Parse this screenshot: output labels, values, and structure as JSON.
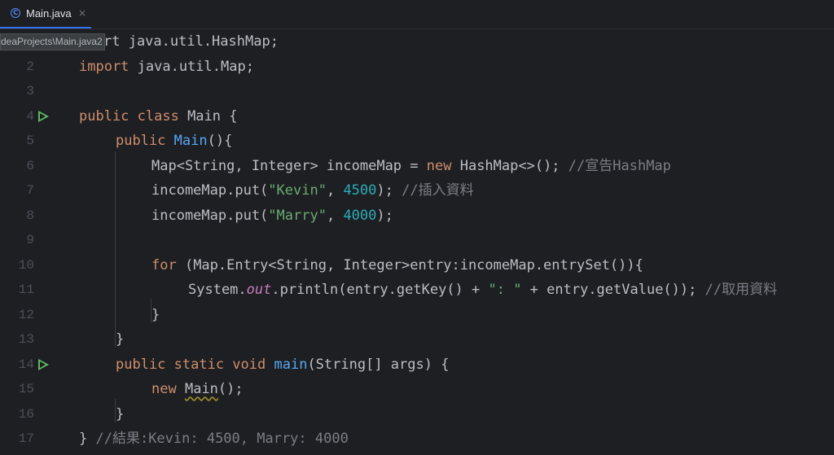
{
  "tab": {
    "icon": "java-class-icon",
    "label": "Main.java",
    "close": "×"
  },
  "tooltip": "deaProjects\\Main.java2",
  "lines": [
    {
      "n": "1"
    },
    {
      "n": "2"
    },
    {
      "n": "3"
    },
    {
      "n": "4"
    },
    {
      "n": "5"
    },
    {
      "n": "6"
    },
    {
      "n": "7"
    },
    {
      "n": "8"
    },
    {
      "n": "9"
    },
    {
      "n": "10"
    },
    {
      "n": "11"
    },
    {
      "n": "12"
    },
    {
      "n": "13"
    },
    {
      "n": "14"
    },
    {
      "n": "15"
    },
    {
      "n": "16"
    },
    {
      "n": "17"
    }
  ],
  "code": {
    "l1": {
      "kw": "import",
      "rest": "rt java.util.HashMap;"
    },
    "l2": {
      "kw": "import",
      "rest": " java.util.Map;"
    },
    "l4": {
      "kw": "public class",
      "rest": " Main {"
    },
    "l5": {
      "kw": "public",
      "fn": "Main",
      "rest": "(){"
    },
    "l6": {
      "a": "Map<String, Integer> incomeMap = ",
      "kw": "new",
      "b": " HashMap<>(); ",
      "cmt": "//宣告HashMap"
    },
    "l7": {
      "a": "incomeMap.put(",
      "str": "\"Kevin\"",
      "b": ", ",
      "num": "4500",
      "c": "); ",
      "cmt": "//插入資料"
    },
    "l8": {
      "a": "incomeMap.put(",
      "str": "\"Marry\"",
      "b": ", ",
      "num": "4000",
      "c": ");"
    },
    "l10": {
      "kw": "for",
      "a": " (Map.Entry<String, Integer>entry:incomeMap.entrySet()){"
    },
    "l11": {
      "a": "System.",
      "st": "out",
      "b": ".println(entry.getKey() + ",
      "str": "\": \"",
      "c": " + entry.getValue()); ",
      "cmt": "//取用資料"
    },
    "l12": {
      "a": "}"
    },
    "l13": {
      "a": "}"
    },
    "l14": {
      "kw": "public static void",
      "fn": "main",
      "a": "(String[] args) {"
    },
    "l15": {
      "kw": "new",
      "warn": "Main",
      "a": "();"
    },
    "l16": {
      "a": "}"
    },
    "l17": {
      "a": "} ",
      "cmt": "//結果:Kevin: 4500, Marry: 4000"
    }
  },
  "colors": {
    "background": "#1e1f22",
    "keyword": "#cf8e6d",
    "string": "#6aab73",
    "number": "#2aacb8",
    "comment": "#7a7e85",
    "function": "#56a8f5",
    "static_field": "#c77dbb",
    "run_icon": "#5fb865"
  }
}
